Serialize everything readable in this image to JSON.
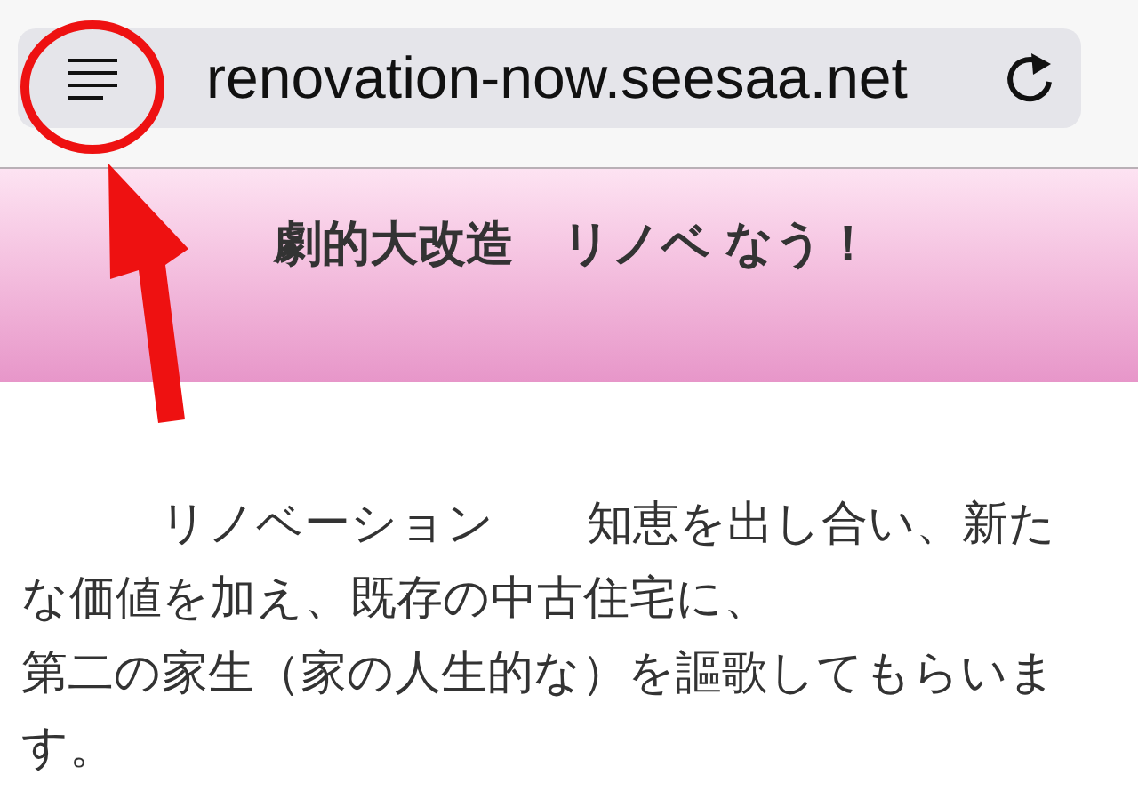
{
  "browser": {
    "url": "renovation-now.seesaa.net"
  },
  "header": {
    "title": "劇的大改造　リノベ なう！"
  },
  "article": {
    "lines": [
      "　　　リノベーション　　知恵を出し合い、新た",
      "な価値を加え、既存の中古住宅に、",
      "第二の家生（家の人生的な）を謳歌してもらいま",
      "す。"
    ]
  }
}
